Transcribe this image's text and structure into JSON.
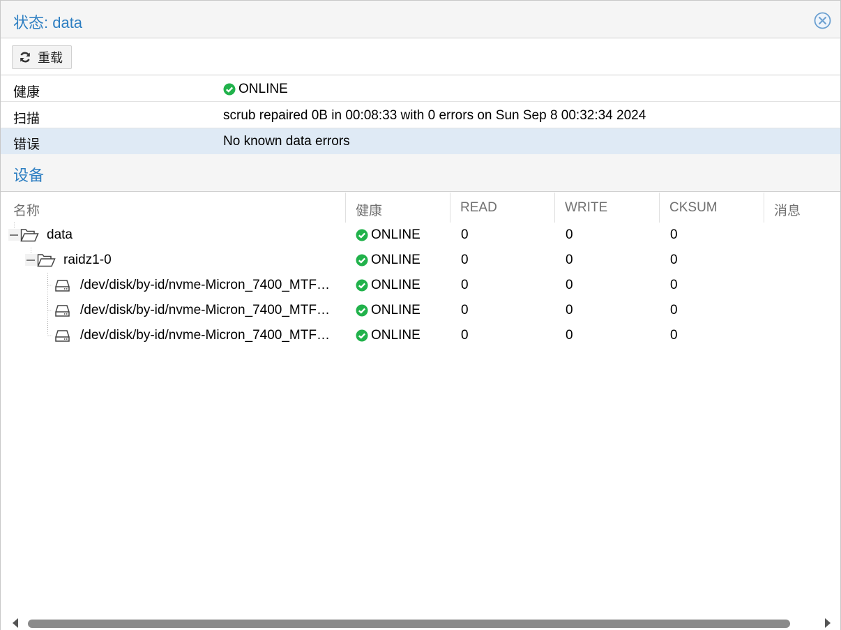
{
  "window": {
    "title": "状态: data"
  },
  "toolbar": {
    "reload_label": "重载"
  },
  "status": [
    {
      "key": "健康",
      "value": "ONLINE",
      "icon": "check-circle-icon"
    },
    {
      "key": "扫描",
      "value": "scrub repaired 0B in 00:08:33 with 0 errors on Sun Sep 8 00:32:34 2024"
    },
    {
      "key": "错误",
      "value": "No known data errors",
      "selected": true
    }
  ],
  "devices": {
    "title": "设备",
    "columns": [
      "名称",
      "健康",
      "READ",
      "WRITE",
      "CKSUM",
      "消息"
    ],
    "rows": [
      {
        "name": "data",
        "health": "ONLINE",
        "read": "0",
        "write": "0",
        "cksum": "0",
        "msg": "",
        "icon": "folder-open-icon"
      },
      {
        "name": "raidz1-0",
        "health": "ONLINE",
        "read": "0",
        "write": "0",
        "cksum": "0",
        "msg": "",
        "icon": "folder-open-icon"
      },
      {
        "name": "/dev/disk/by-id/nvme-Micron_7400_MTF…",
        "health": "ONLINE",
        "read": "0",
        "write": "0",
        "cksum": "0",
        "msg": "",
        "icon": "hdd-icon"
      },
      {
        "name": "/dev/disk/by-id/nvme-Micron_7400_MTF…",
        "health": "ONLINE",
        "read": "0",
        "write": "0",
        "cksum": "0",
        "msg": "",
        "icon": "hdd-icon"
      },
      {
        "name": "/dev/disk/by-id/nvme-Micron_7400_MTF…",
        "health": "ONLINE",
        "read": "0",
        "write": "0",
        "cksum": "0",
        "msg": "",
        "icon": "hdd-icon"
      }
    ]
  },
  "colors": {
    "accent": "#2e7fc2",
    "online": "#21b24b",
    "selected_row": "#dfeaf5"
  }
}
